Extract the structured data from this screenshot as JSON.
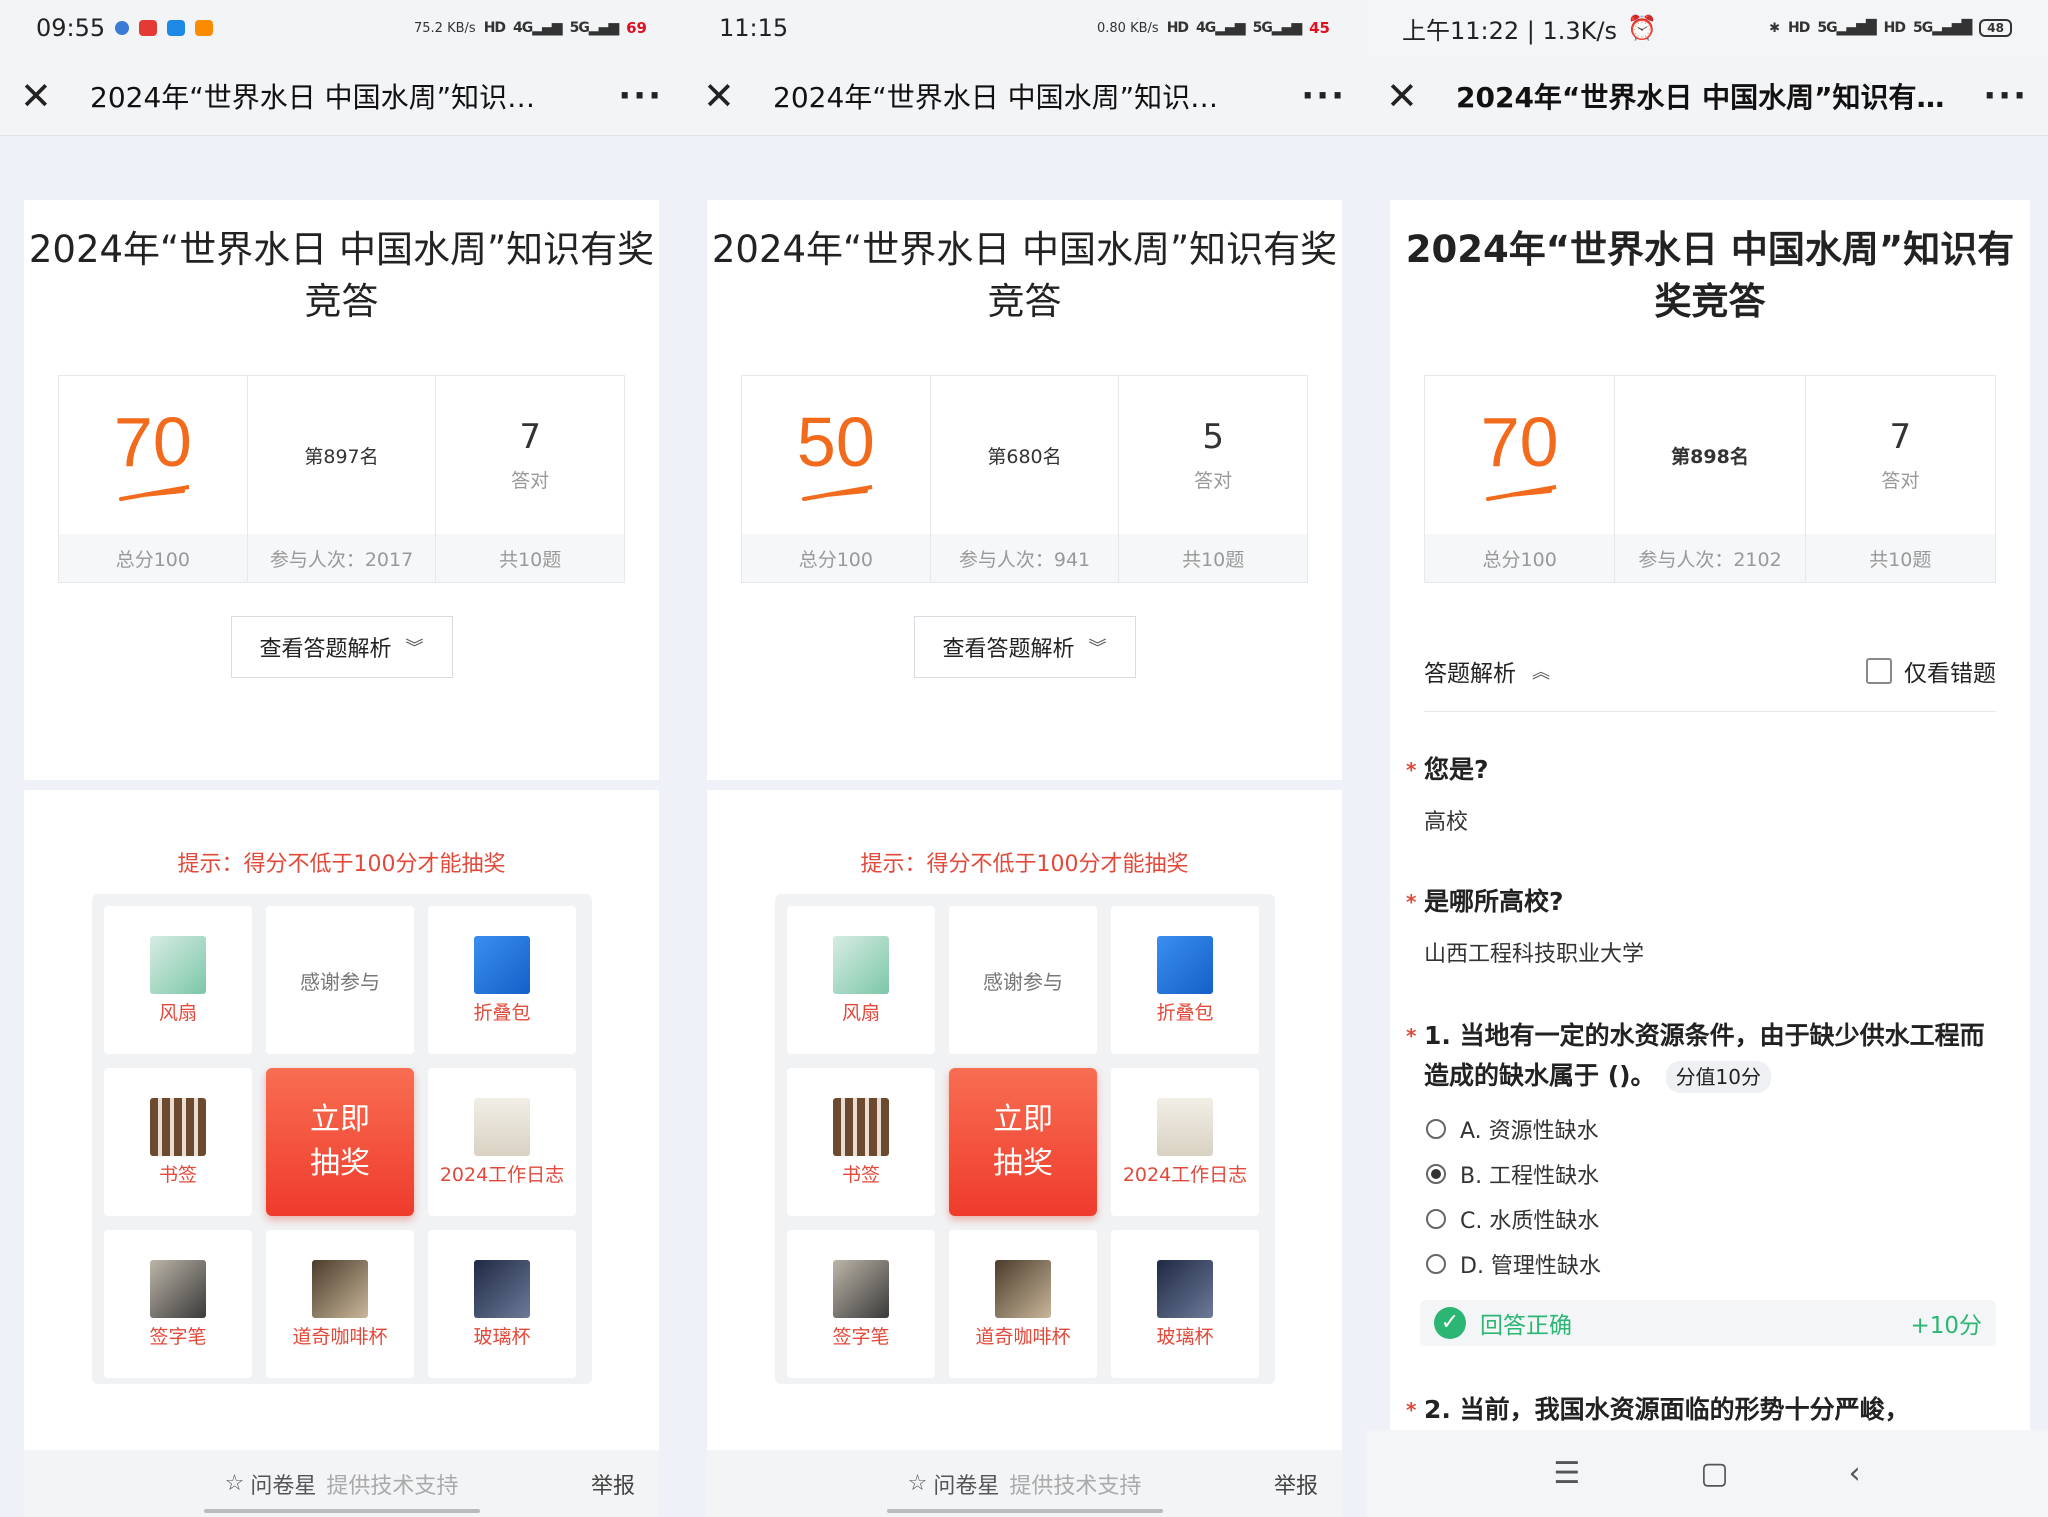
{
  "survey_title": "2024年“世界水日 中国水周”知识有奖竞答",
  "tab_title_short": "2024年“世界水日 中国水周”知识…",
  "tab_title_short_p3": "2024年“世界水日 中国水周”知识有…",
  "phones": [
    {
      "time": "09:55",
      "net_speed": "75.2 KB/s",
      "battery": "69",
      "score": "70",
      "total": "总分100",
      "rank": "第897名",
      "participants": "参与人次：2017",
      "correct": "7",
      "correct_label": "答对",
      "question_count": "共10题"
    },
    {
      "time": "11:15",
      "net_speed": "0.80 KB/s",
      "battery": "45",
      "score": "50",
      "total": "总分100",
      "rank": "第680名",
      "participants": "参与人次：941",
      "correct": "5",
      "correct_label": "答对",
      "question_count": "共10题"
    },
    {
      "time": "上午11:22 | 1.3K/s",
      "battery": "48",
      "score": "70",
      "total": "总分100",
      "rank": "第898名",
      "participants": "参与人次：2102",
      "correct": "7",
      "correct_label": "答对",
      "question_count": "共10题"
    }
  ],
  "view_analysis_label": "查看答题解析",
  "hint": "提示：得分不低于100分才能抽奖",
  "prizes": {
    "fan": "风扇",
    "thanks": "感谢参与",
    "bag": "折叠包",
    "bookmark": "书签",
    "draw": "立即抽奖",
    "draw_line1": "立即",
    "draw_line2": "抽奖",
    "diary": "2024工作日志",
    "pen": "签字笔",
    "coffee": "道奇咖啡杯",
    "glass": "玻璃杯"
  },
  "footer": {
    "brand": "问卷星",
    "support": "提供技术支持",
    "report": "举报"
  },
  "analysis": {
    "title": "答题解析",
    "wrong_only": "仅看错题",
    "q_who": "您是?",
    "a_who": "高校",
    "q_school": "是哪所高校?",
    "a_school": "山西工程科技职业大学",
    "q1": "1. 当地有一定的水资源条件，由于缺少供水工程而造成的缺水属于 ()。",
    "q1_score": "分值10分",
    "options": [
      "A. 资源性缺水",
      "B. 工程性缺水",
      "C. 水质性缺水",
      "D. 管理性缺水"
    ],
    "selected_index": 1,
    "result": "回答正确",
    "points": "+10分",
    "q2": "2. 当前，我国水资源面临的形势十分严峻，"
  },
  "colors": {
    "accent_orange": "#f26b1d",
    "hint_red": "#e2493a",
    "correct_green": "#2bb673"
  }
}
